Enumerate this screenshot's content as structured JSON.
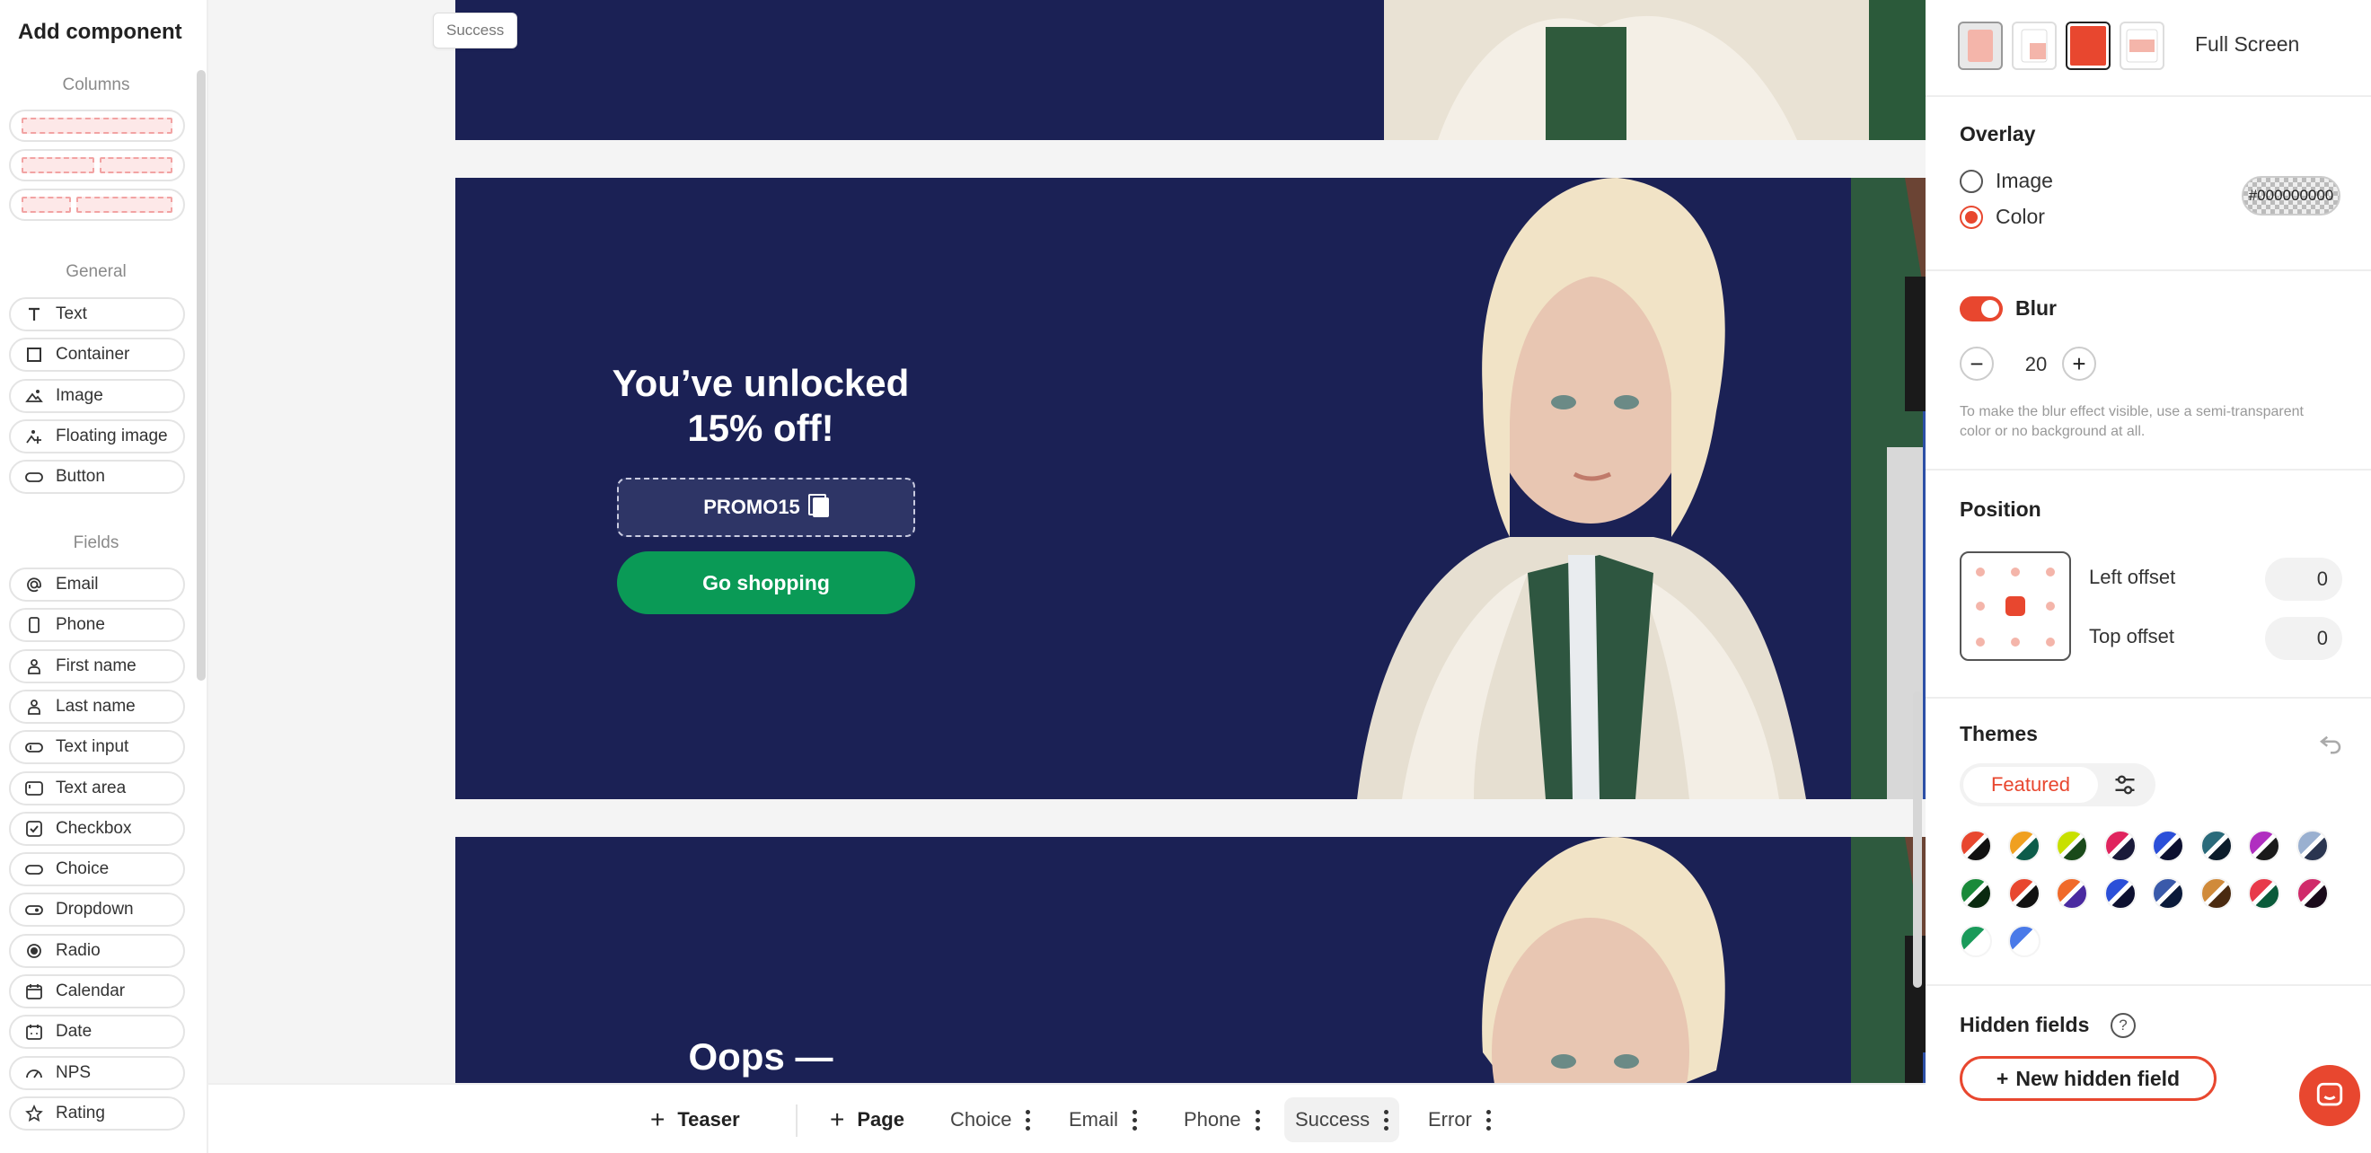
{
  "sidebar": {
    "title": "Add component",
    "sections": {
      "columns": "Columns",
      "general": "General",
      "fields": "Fields"
    },
    "general_items": [
      {
        "label": "Text",
        "icon": "text-icon"
      },
      {
        "label": "Container",
        "icon": "container-icon"
      },
      {
        "label": "Image",
        "icon": "image-icon"
      },
      {
        "label": "Floating image",
        "icon": "floating-image-icon"
      },
      {
        "label": "Button",
        "icon": "button-icon"
      }
    ],
    "field_items": [
      {
        "label": "Email",
        "icon": "at-icon"
      },
      {
        "label": "Phone",
        "icon": "phone-icon"
      },
      {
        "label": "First name",
        "icon": "person-icon"
      },
      {
        "label": "Last name",
        "icon": "person-icon"
      },
      {
        "label": "Text input",
        "icon": "text-input-icon"
      },
      {
        "label": "Text area",
        "icon": "text-area-icon"
      },
      {
        "label": "Checkbox",
        "icon": "checkbox-icon"
      },
      {
        "label": "Choice",
        "icon": "choice-icon"
      },
      {
        "label": "Dropdown",
        "icon": "dropdown-icon"
      },
      {
        "label": "Radio",
        "icon": "radio-icon"
      },
      {
        "label": "Calendar",
        "icon": "calendar-icon"
      },
      {
        "label": "Date",
        "icon": "date-icon"
      },
      {
        "label": "NPS",
        "icon": "nps-icon"
      },
      {
        "label": "Rating",
        "icon": "star-icon"
      }
    ]
  },
  "canvas": {
    "page_tag": "Success",
    "success_frame": {
      "headline_line1": "You’ve unlocked",
      "headline_line2": "15% off!",
      "promo_code": "PROMO15",
      "cta_label": "Go shopping"
    },
    "error_frame": {
      "headline": "Oops —"
    },
    "colors": {
      "frame_bg": "#1b2155",
      "cta_bg": "#0a9a56"
    }
  },
  "tabs": [
    {
      "label": "Teaser",
      "type": "add"
    },
    {
      "label": "Page",
      "type": "add"
    },
    {
      "label": "Choice",
      "type": "page"
    },
    {
      "label": "Email",
      "type": "page"
    },
    {
      "label": "Phone",
      "type": "page"
    },
    {
      "label": "Success",
      "type": "page",
      "active": true
    },
    {
      "label": "Error",
      "type": "page"
    }
  ],
  "panel": {
    "layout": {
      "selected_label": "Full Screen"
    },
    "overlay": {
      "title": "Overlay",
      "options": [
        "Image",
        "Color"
      ],
      "selected": "Color",
      "color_value": "#000000000"
    },
    "blur": {
      "title": "Blur",
      "enabled": true,
      "value": "20",
      "hint": "To make the blur effect visible, use a semi-transparent color or no background at all."
    },
    "position": {
      "title": "Position",
      "left_offset_label": "Left offset",
      "left_offset_value": "0",
      "top_offset_label": "Top offset",
      "top_offset_value": "0"
    },
    "themes": {
      "title": "Themes",
      "tab_label": "Featured",
      "swatches": [
        [
          "#e8472f",
          "#111111"
        ],
        [
          "#f0a020",
          "#0d5c4a"
        ],
        [
          "#c8e000",
          "#1a4a1a"
        ],
        [
          "#e0245e",
          "#1a1a3a"
        ],
        [
          "#2b4fd8",
          "#0d1030"
        ],
        [
          "#2a6a7a",
          "#0c1c2a"
        ],
        [
          "#b02ec0",
          "#1a1a1a"
        ],
        [
          "#9ab0d0",
          "#2a3550"
        ],
        [
          "#1a8a3a",
          "#0a2a10"
        ],
        [
          "#e8472f",
          "#111111"
        ],
        [
          "#f06a2a",
          "#4a2aa0"
        ],
        [
          "#2b4fd8",
          "#0d1030"
        ],
        [
          "#3a5aaa",
          "#0a1a3a"
        ],
        [
          "#d08a3a",
          "#4a2a10"
        ],
        [
          "#e83a4a",
          "#0a5a3a"
        ],
        [
          "#d02a6a",
          "#1a0a1a"
        ],
        [
          "#1a9a5a",
          "#ffffff"
        ],
        [
          "#4a7ae8",
          "#ffffff"
        ]
      ]
    },
    "hidden_fields": {
      "title": "Hidden fields",
      "button_label": "New hidden field"
    },
    "accent_color": "#e8472f"
  }
}
